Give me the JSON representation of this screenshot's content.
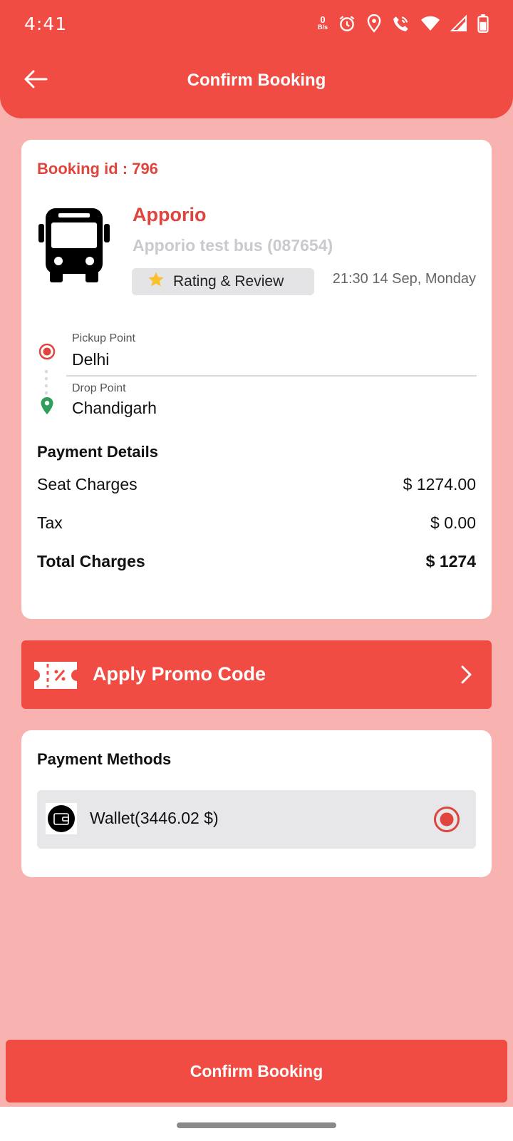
{
  "status_bar": {
    "time": "4:41",
    "net_speed_value": "0",
    "net_speed_unit": "B/s",
    "icons": [
      "alarm-icon",
      "location-icon",
      "wifi-call-icon",
      "wifi-icon",
      "signal-icon",
      "battery-icon"
    ]
  },
  "toolbar": {
    "title": "Confirm Booking",
    "back_icon": "arrow-left-icon"
  },
  "booking": {
    "booking_id_label": "Booking id : 796",
    "operator": "Apporio",
    "bus_name": "Apporio test bus (087654)",
    "rating_label": "Rating & Review",
    "datetime": "21:30 14 Sep, Monday",
    "pickup_label": "Pickup Point",
    "pickup_value": "Delhi",
    "drop_label": "Drop Point",
    "drop_value": "Chandigarh"
  },
  "payment_details": {
    "title": "Payment Details",
    "rows": [
      {
        "label": "Seat Charges",
        "value": "$ 1274.00"
      },
      {
        "label": "Tax",
        "value": "$ 0.00"
      },
      {
        "label": "Total Charges",
        "value": "$ 1274"
      }
    ]
  },
  "promo": {
    "label": "Apply Promo Code"
  },
  "payment_methods": {
    "title": "Payment Methods",
    "wallet_label": "Wallet(3446.02 $)",
    "selected": true
  },
  "confirm_button": {
    "label": "Confirm Booking"
  },
  "colors": {
    "primary": "#f04c43",
    "background": "#f8b3b1",
    "accent_text": "#e0453d",
    "muted": "#c9c9cf",
    "drop_pin": "#2e9e5b"
  }
}
